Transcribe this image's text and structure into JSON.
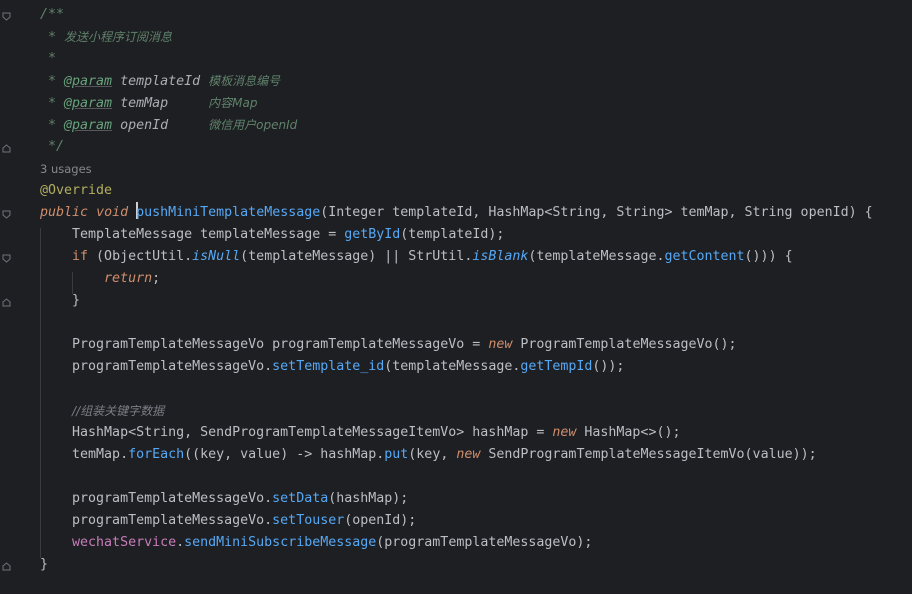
{
  "editor": {
    "doc": {
      "open": "/**",
      "summary_star": " * ",
      "summary": "发送小程序订阅消息",
      "blank": " *",
      "params": [
        {
          "tag": "@param",
          "name": "templateId",
          "pad": " ",
          "desc": "模板消息编号"
        },
        {
          "tag": "@param",
          "name": "temMap",
          "pad": "     ",
          "desc": "内容Map"
        },
        {
          "tag": "@param",
          "name": "openId",
          "pad": "     ",
          "desc": "微信用户openId"
        }
      ],
      "close": " */"
    },
    "usages": "3 usages",
    "annotation": "@Override",
    "signature": {
      "kw1": "public",
      "kw2": "void",
      "method": "pushMiniTemplateMessage",
      "params": "(Integer templateId, HashMap<String, String> temMap, String openId) {"
    },
    "body": {
      "l1_type": "TemplateMessage",
      "l1_var": " templateMessage = ",
      "l1_call": "getById",
      "l1_rest": "(templateId);",
      "l2_kw": "if",
      "l2_a": " (ObjectUtil.",
      "l2_call1": "isNull",
      "l2_b": "(templateMessage) || StrUtil.",
      "l2_call2": "isBlank",
      "l2_c": "(templateMessage.",
      "l2_call3": "getContent",
      "l2_d": "())) {",
      "l3_kw": "return",
      "l3_rest": ";",
      "l4": "}",
      "l5_type": "ProgramTemplateMessageVo",
      "l5_var": " programTemplateMessageVo = ",
      "l5_new": "new",
      "l5_type2": " ProgramTemplateMessageVo",
      "l5_rest": "();",
      "l6_a": "programTemplateMessageVo.",
      "l6_call": "setTemplate_id",
      "l6_b": "(templateMessage.",
      "l6_call2": "getTempId",
      "l6_c": "());",
      "comment": "//组装关键字数据",
      "l7_a": "HashMap<String, SendProgramTemplateMessageItemVo> hashMap = ",
      "l7_new": "new",
      "l7_b": " HashMap<>();",
      "l8_a": "temMap.",
      "l8_call": "forEach",
      "l8_b": "((key, value) -> hashMap.",
      "l8_call2": "put",
      "l8_c": "(key, ",
      "l8_new": "new",
      "l8_d": " SendProgramTemplateMessageItemVo(value));",
      "l9_a": "programTemplateMessageVo.",
      "l9_call": "setData",
      "l9_b": "(hashMap);",
      "l10_a": "programTemplateMessageVo.",
      "l10_call": "setTouser",
      "l10_b": "(openId);",
      "l11_field": "wechatService",
      "l11_a": ".",
      "l11_call": "sendMiniSubscribeMessage",
      "l11_b": "(programTemplateMessageVo);",
      "close": "}"
    }
  },
  "colors": {
    "background": "#1e1f22",
    "keyword": "#cf8e6d",
    "method_call": "#56a8f5",
    "annotation": "#b3ae60",
    "doc_comment": "#5f826b",
    "field": "#c77dbb",
    "comment": "#7a7e85"
  }
}
